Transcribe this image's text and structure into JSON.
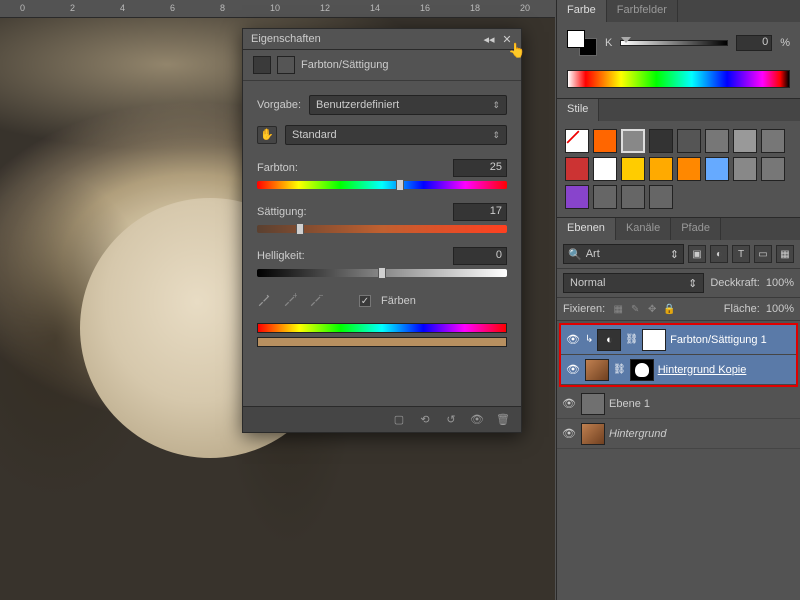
{
  "ruler_marks": [
    "0",
    "2",
    "4",
    "6",
    "8",
    "10",
    "12",
    "14",
    "16",
    "18",
    "20"
  ],
  "props": {
    "panel_title": "Eigenschaften",
    "adjustment_name": "Farbton/Sättigung",
    "preset_label": "Vorgabe:",
    "preset_value": "Benutzerdefiniert",
    "channel_value": "Standard",
    "hue_label": "Farbton:",
    "hue_value": "25",
    "sat_label": "Sättigung:",
    "sat_value": "17",
    "lig_label": "Helligkeit:",
    "lig_value": "0",
    "colorize_label": "Färben"
  },
  "color_panel": {
    "tab_color": "Farbe",
    "tab_swatches": "Farbfelder",
    "k_label": "K",
    "k_value": "0",
    "k_pct": "%"
  },
  "styles_panel": {
    "tab": "Stile",
    "swatches": [
      "#fff",
      "#ff6600",
      "#888888",
      "#333333",
      "#555",
      "#777",
      "#999",
      "#777",
      "#cc3333",
      "#fff",
      "#ffcc00",
      "#ffaa00",
      "#ff8800",
      "#66aaff",
      "#888",
      "#777",
      "#8844cc",
      "#666",
      "#666",
      "#666"
    ]
  },
  "layers_panel": {
    "tab_layers": "Ebenen",
    "tab_channels": "Kanäle",
    "tab_paths": "Pfade",
    "search_label": "Art",
    "blend_mode": "Normal",
    "opacity_label": "Deckkraft:",
    "opacity_value": "100%",
    "lock_label": "Fixieren:",
    "fill_label": "Fläche:",
    "fill_value": "100%",
    "layers": [
      {
        "name": "Farbton/Sättigung 1",
        "type": "adj",
        "sel": true
      },
      {
        "name": "Hintergrund Kopie",
        "type": "img",
        "sel": true,
        "underline": true
      },
      {
        "name": "Ebene 1",
        "type": "plain"
      },
      {
        "name": "Hintergrund",
        "type": "img",
        "italic": true
      }
    ]
  }
}
